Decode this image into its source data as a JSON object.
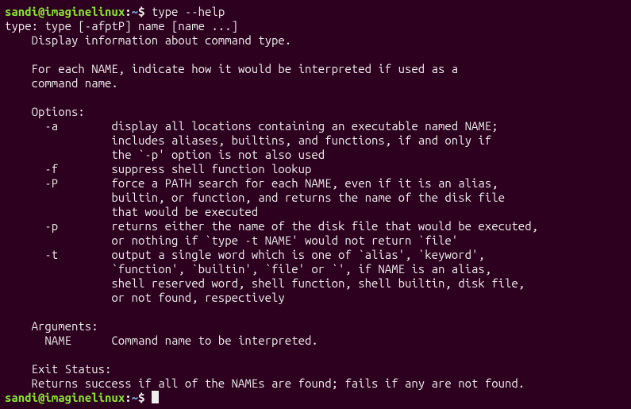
{
  "prompt1": {
    "user": "sandi",
    "at": "@",
    "host": "imaginelinux",
    "colon": ":",
    "path": "~",
    "dollar": "$ ",
    "command": "type --help"
  },
  "output": {
    "l01": "type: type [-afptP] name [name ...]",
    "l02": "    Display information about command type.",
    "l03": "    ",
    "l04": "    For each NAME, indicate how it would be interpreted if used as a",
    "l05": "    command name.",
    "l06": "    ",
    "l07": "    Options:",
    "l08": "      -a        display all locations containing an executable named NAME;",
    "l09": "                includes aliases, builtins, and functions, if and only if",
    "l10": "                the `-p' option is not also used",
    "l11": "      -f        suppress shell function lookup",
    "l12": "      -P        force a PATH search for each NAME, even if it is an alias,",
    "l13": "                builtin, or function, and returns the name of the disk file",
    "l14": "                that would be executed",
    "l15": "      -p        returns either the name of the disk file that would be executed,",
    "l16": "                or nothing if `type -t NAME' would not return `file'",
    "l17": "      -t        output a single word which is one of `alias', `keyword',",
    "l18": "                `function', `builtin', `file' or `', if NAME is an alias,",
    "l19": "                shell reserved word, shell function, shell builtin, disk file,",
    "l20": "                or not found, respectively",
    "l21": "    ",
    "l22": "    Arguments:",
    "l23": "      NAME      Command name to be interpreted.",
    "l24": "    ",
    "l25": "    Exit Status:",
    "l26": "    Returns success if all of the NAMEs are found; fails if any are not found."
  },
  "prompt2": {
    "user": "sandi",
    "at": "@",
    "host": "imaginelinux",
    "colon": ":",
    "path": "~",
    "dollar": "$ "
  }
}
